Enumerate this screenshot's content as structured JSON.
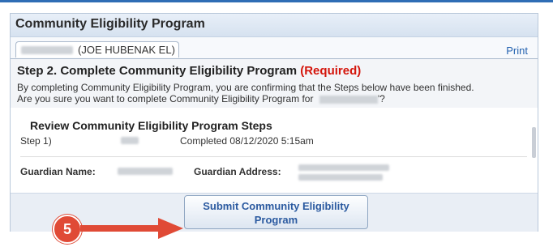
{
  "header": {
    "title": "Community Eligibility Program"
  },
  "tab": {
    "student_name": "(JOE HUBENAK EL)"
  },
  "actions": {
    "print_label": "Print"
  },
  "step": {
    "title": "Step 2. Complete Community Eligibility Program",
    "required_label": "(Required)",
    "desc_line1": "By completing Community Eligibility Program, you are confirming that the Steps below have been finished.",
    "desc_line2_prefix": "Are you sure you want to complete Community Eligibility Program for",
    "desc_line2_suffix": "'?"
  },
  "review": {
    "title": "Review Community Eligibility Program Steps",
    "step_label": "Step 1)",
    "step_status": "Completed 08/12/2020 5:15am"
  },
  "guardian": {
    "name_label": "Guardian Name:",
    "address_label": "Guardian Address:"
  },
  "submit": {
    "line1": "Submit Community Eligibility",
    "line2": "Program"
  },
  "annotation": {
    "step_number": "5"
  },
  "colors": {
    "accent": "#2f6db5",
    "required": "#d4150b",
    "badge": "#e04a36",
    "link": "#2563b0"
  }
}
